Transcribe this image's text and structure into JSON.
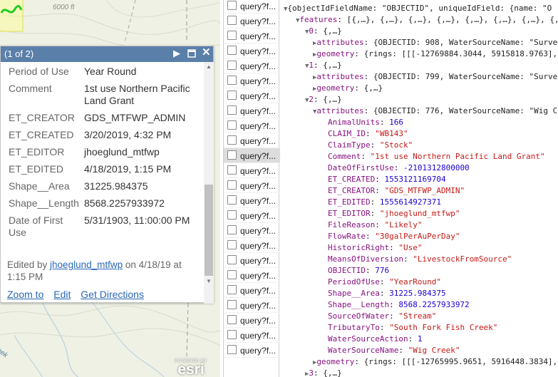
{
  "map": {
    "elevation_label": "6000 ft",
    "creek_label": "eek",
    "attribution_powered": "POWERED BY",
    "attribution_logo": "esri"
  },
  "popup": {
    "count": "(1 of 2)",
    "attributes": [
      {
        "key": "Period of Use",
        "value": "Year Round"
      },
      {
        "key": "Comment",
        "value": "1st use Northern Pacific Land Grant"
      },
      {
        "key": "ET_CREATOR",
        "value": "GDS_MTFWP_ADMIN"
      },
      {
        "key": "ET_CREATED",
        "value": "3/20/2019, 4:32 PM"
      },
      {
        "key": "ET_EDITOR",
        "value": "jhoeglund_mtfwp"
      },
      {
        "key": "ET_EDITED",
        "value": "4/18/2019, 1:15 PM"
      },
      {
        "key": "Shape__Area",
        "value": "31225.984375"
      },
      {
        "key": "Shape__Length",
        "value": "8568.2257933972"
      },
      {
        "key": "Date of First Use",
        "value": "5/31/1903, 11:00:00 PM"
      }
    ],
    "edited_prefix": "Edited by ",
    "edited_user": "jhoeglund_mtfwp",
    "edited_suffix": " on 4/18/19 at 1:15 PM",
    "actions": {
      "zoom": "Zoom to",
      "edit": "Edit",
      "directions": "Get Directions"
    }
  },
  "network": {
    "request_name": "query?f...",
    "rows": 24,
    "selected_index": 10
  },
  "json_preview": {
    "root": "{objectIdFieldName: \"OBJECTID\", uniqueIdField: {name: \"O",
    "features_summary": "[{,…}, {,…}, {,…}, {,…}, {,…}, {,…}, {,…}, {,",
    "f0_attrs": "{OBJECTID: 908, WaterSourceName: \"Surve",
    "f0_geom": "{rings: [[[-12769884.3044, 5915818.9763],",
    "f1_attrs": "{OBJECTID: 799, WaterSourceName: \"Surve",
    "f1_geom": "{,…}",
    "f2_attrs": "{OBJECTID: 776, WaterSourceName: \"Wig C",
    "fields": [
      {
        "key": "AnimalUnits",
        "value": "166",
        "type": "n"
      },
      {
        "key": "CLAIM_ID",
        "value": "\"WB143\"",
        "type": "s"
      },
      {
        "key": "ClaimType",
        "value": "\"Stock\"",
        "type": "s"
      },
      {
        "key": "Comment",
        "value": "\"1st use Northern Pacific Land Grant\"",
        "type": "s"
      },
      {
        "key": "DateOfFirstUse",
        "value": "-2101312800000",
        "type": "n"
      },
      {
        "key": "ET_CREATED",
        "value": "1553121169704",
        "type": "n"
      },
      {
        "key": "ET_CREATOR",
        "value": "\"GDS_MTFWP_ADMIN\"",
        "type": "s"
      },
      {
        "key": "ET_EDITED",
        "value": "1555614927371",
        "type": "n"
      },
      {
        "key": "ET_EDITOR",
        "value": "\"jhoeglund_mtfwp\"",
        "type": "s"
      },
      {
        "key": "FileReason",
        "value": "\"Likely\"",
        "type": "s"
      },
      {
        "key": "FlowRate",
        "value": "\"30galPerAuPerDay\"",
        "type": "s"
      },
      {
        "key": "HistoricRight",
        "value": "\"Use\"",
        "type": "s"
      },
      {
        "key": "MeansOfDiversion",
        "value": "\"LivestockFromSource\"",
        "type": "s"
      },
      {
        "key": "OBJECTID",
        "value": "776",
        "type": "n"
      },
      {
        "key": "PeriodOfUse",
        "value": "\"YearRound\"",
        "type": "s"
      },
      {
        "key": "Shape__Area",
        "value": "31225.984375",
        "type": "n"
      },
      {
        "key": "Shape__Length",
        "value": "8568.2257933972",
        "type": "n"
      },
      {
        "key": "SourceOfWater",
        "value": "\"Stream\"",
        "type": "s"
      },
      {
        "key": "TributaryTo",
        "value": "\"South Fork Fish Creek\"",
        "type": "s"
      },
      {
        "key": "WaterSourceAction",
        "value": "1",
        "type": "n"
      },
      {
        "key": "WaterSourceName",
        "value": "\"Wig Creek\"",
        "type": "s"
      }
    ],
    "f2_geom": "{rings: [[[-12765995.9651, 5916448.3834],",
    "f3": "{,…}"
  }
}
